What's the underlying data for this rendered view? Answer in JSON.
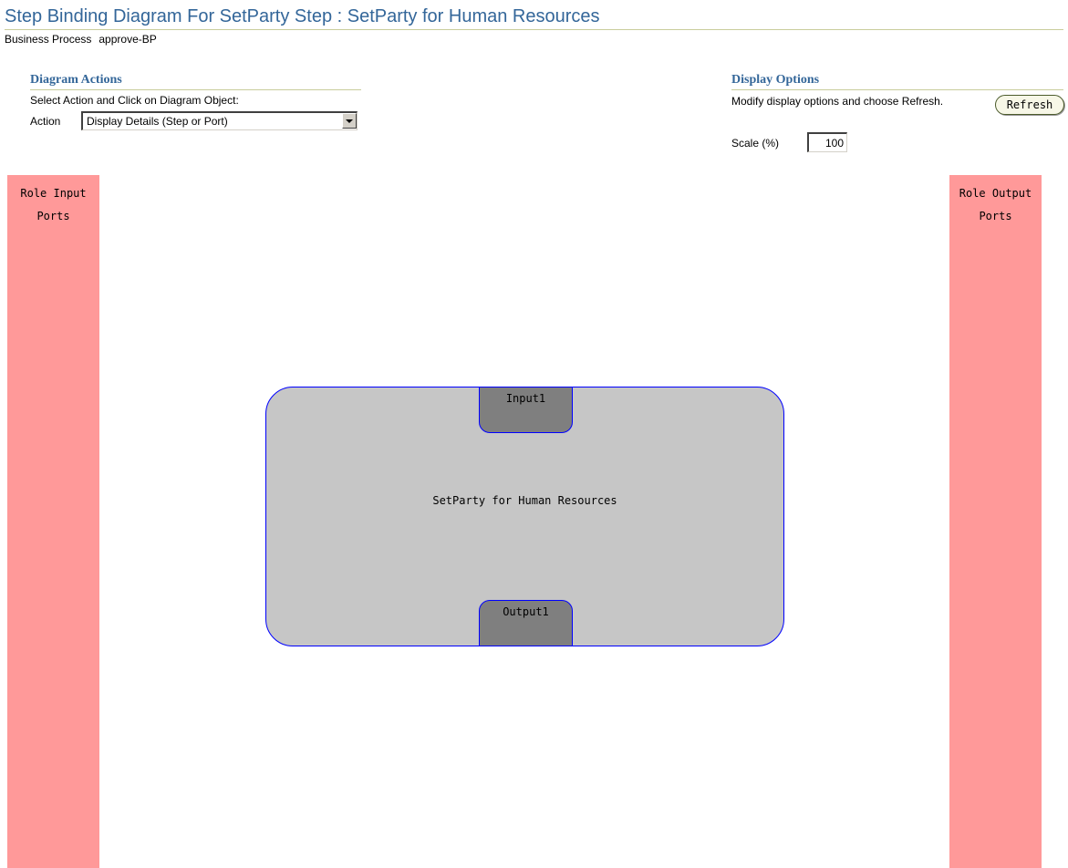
{
  "page": {
    "title": "Step Binding Diagram For SetParty Step : SetParty for Human Resources",
    "business_process_label": "Business Process",
    "business_process_value": "approve-BP"
  },
  "diagram_actions": {
    "header": "Diagram Actions",
    "instruction": "Select Action and Click on Diagram Object:",
    "action_label": "Action",
    "action_selected": "Display Details (Step or Port)"
  },
  "display_options": {
    "header": "Display Options",
    "instruction": "Modify display options and choose Refresh.",
    "refresh_label": "Refresh",
    "scale_label": "Scale (%)",
    "scale_value": "100"
  },
  "diagram": {
    "role_input_ports_line1": "Role Input",
    "role_input_ports_line2": "Ports",
    "role_output_ports_line1": "Role Output",
    "role_output_ports_line2": "Ports",
    "step_label": "SetParty for Human Resources",
    "input_port_label": "Input1",
    "output_port_label": "Output1"
  },
  "colors": {
    "title": "#336699",
    "port_column": "#ff9999",
    "step_fill": "#c6c6c6",
    "port_fill": "#7f7f7f",
    "outline": "#0000ff"
  }
}
